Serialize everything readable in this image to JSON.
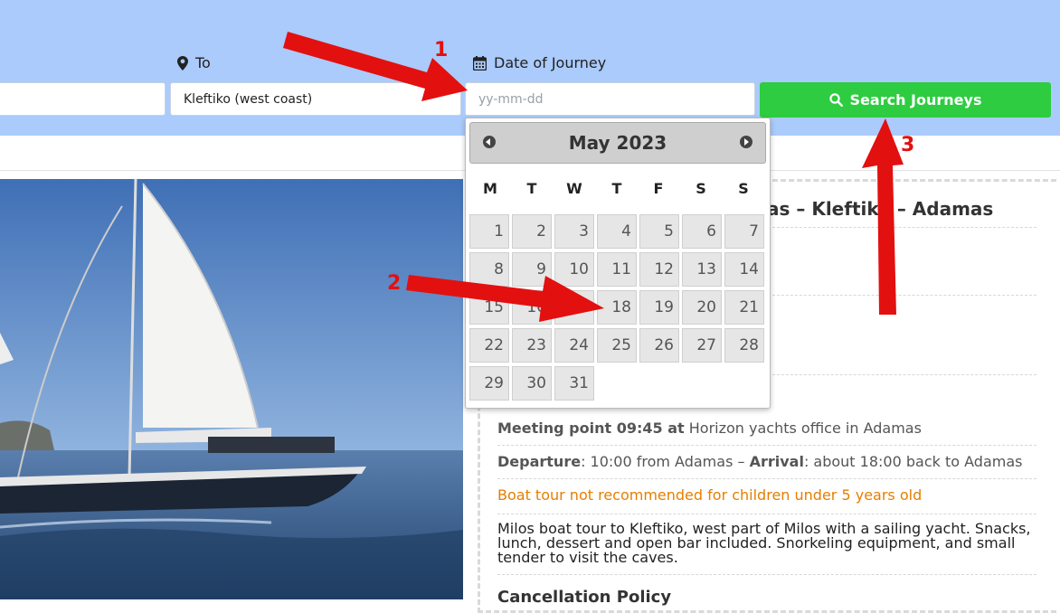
{
  "search": {
    "from_value": "",
    "to_label": "To",
    "to_value": "Kleftiko (west coast)",
    "date_label": "Date of Journey",
    "date_placeholder": "yy-mm-dd",
    "button_label": "Search Journeys"
  },
  "calendar": {
    "month_title": "May 2023",
    "weekdays": [
      "M",
      "T",
      "W",
      "T",
      "F",
      "S",
      "S"
    ],
    "days": [
      "1",
      "2",
      "3",
      "4",
      "5",
      "6",
      "7",
      "8",
      "9",
      "10",
      "11",
      "12",
      "13",
      "14",
      "15",
      "16",
      "17",
      "18",
      "19",
      "20",
      "21",
      "22",
      "23",
      "24",
      "25",
      "26",
      "27",
      "28",
      "29",
      "30",
      "31"
    ]
  },
  "tour": {
    "title": "as – Kleftiko – Adamas",
    "meeting_bold": "Meeting point 09:45 at",
    "meeting_rest": " Horizon yachts office in Adamas",
    "departure_bold": "Departure",
    "departure_rest": ": 10:00 from Adamas – ",
    "arrival_bold": "Arrival",
    "arrival_rest": ": about 18:00 back to Adamas",
    "warning": "Boat tour not recommended for children under 5 years old",
    "description": "Milos boat tour to Kleftiko, west part of Milos with a sailing yacht. Snacks, lunch, dessert and open bar included. Snorkeling equipment, and small tender to visit the caves.",
    "cancellation_heading": "Cancellation Policy"
  },
  "annotations": [
    "1",
    "2",
    "3"
  ],
  "colors": {
    "header_bg": "#aacbfb",
    "search_button": "#2ecc40",
    "arrow": "#e31010",
    "warning": "#e67e00"
  }
}
